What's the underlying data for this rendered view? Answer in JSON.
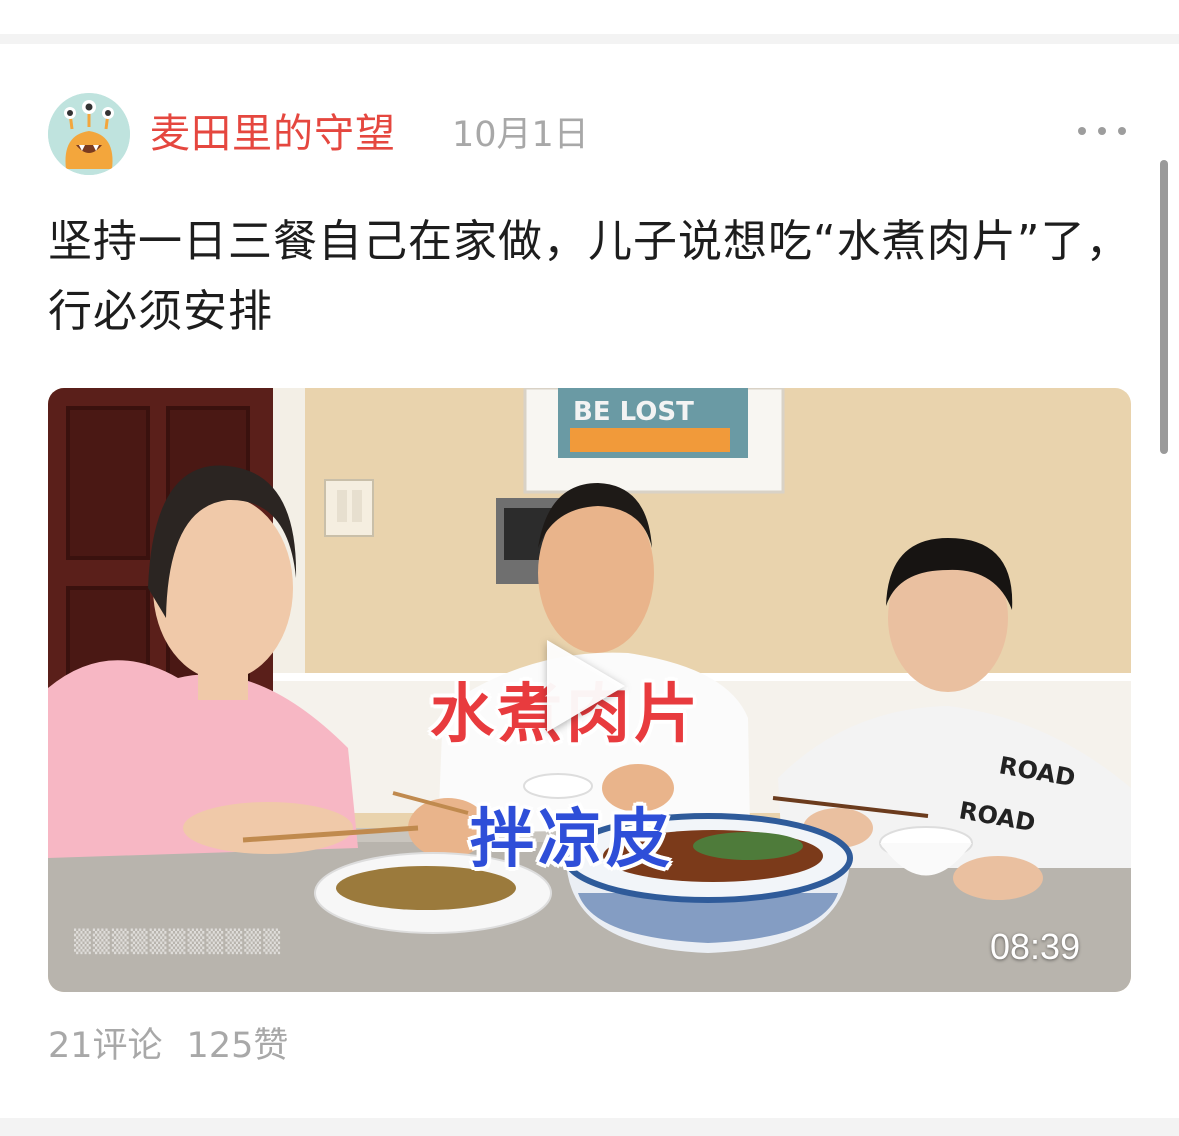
{
  "post": {
    "author": "麦田里的守望",
    "date": "10月1日",
    "title": "坚持一日三餐自己在家做，儿子说想吃“水煮肉片”了，行必须安排",
    "video": {
      "poster_sign_text": "BE LOST",
      "caption_line1": "水煮肉片",
      "caption_line2": "拌凉皮",
      "duration": "08:39",
      "shirt_text": "ROAD"
    },
    "stats": {
      "comments": "21评论",
      "likes": "125赞"
    }
  },
  "icons": {
    "avatar": "monster-avatar-icon",
    "menu": "more-dots-icon",
    "play": "play-icon"
  },
  "colors": {
    "author": "#e5473f",
    "caption_red": "#e83b3e",
    "caption_blue": "#2e4ed8",
    "meta": "#a8a8a8"
  }
}
